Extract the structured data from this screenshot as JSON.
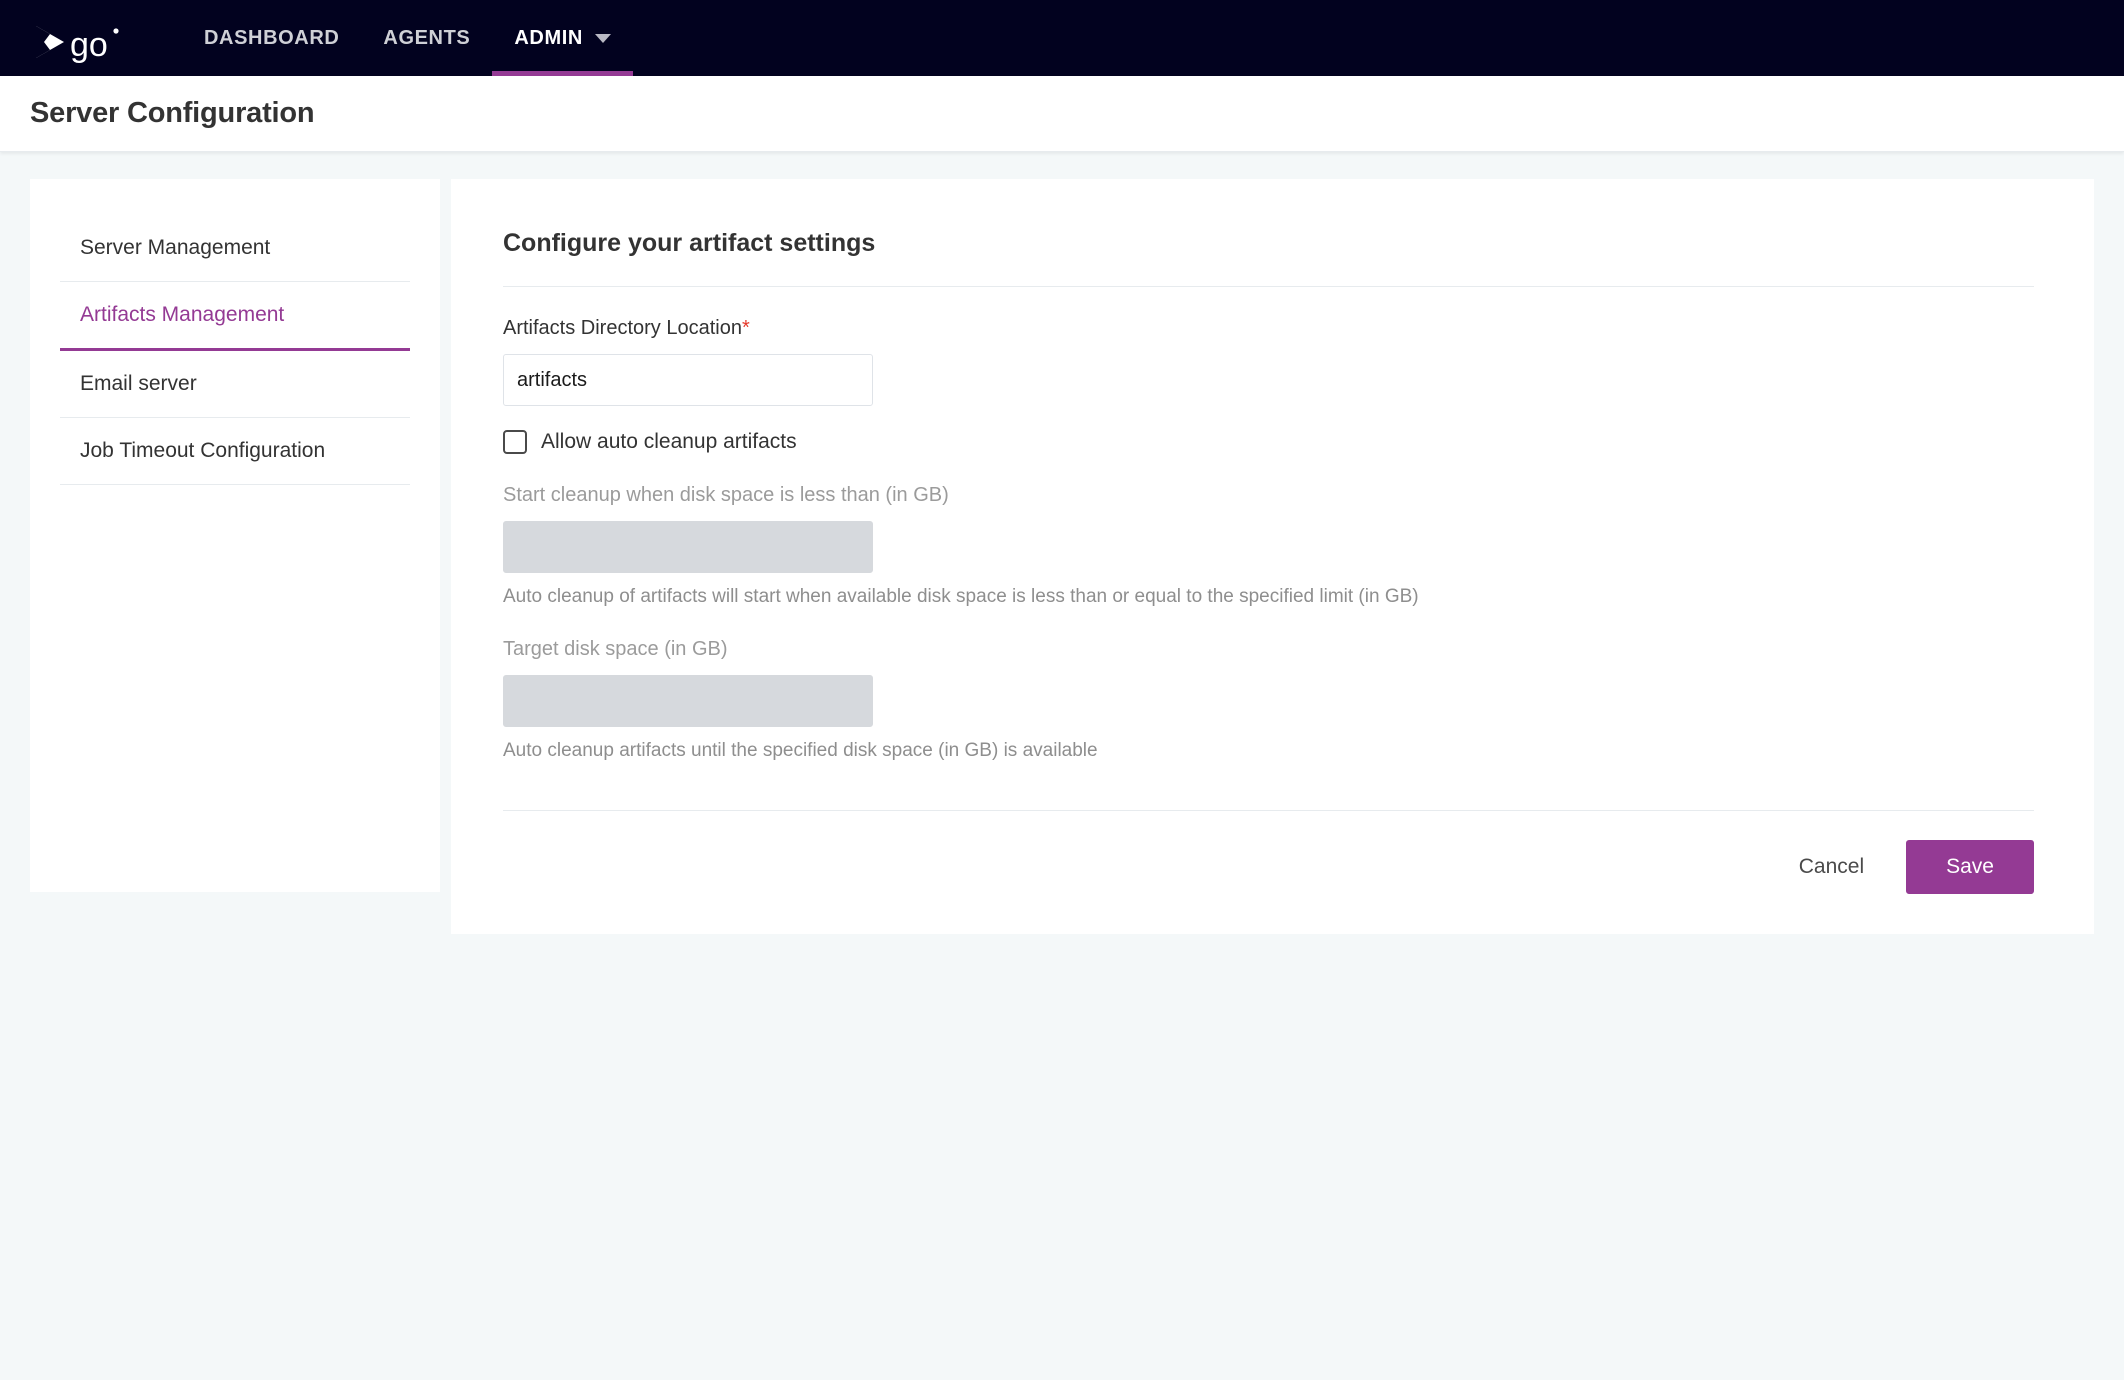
{
  "topnav": {
    "logo_alt": "go",
    "brand_color": "#02021f",
    "accent_color": "#943a94",
    "items": [
      {
        "label": "DASHBOARD",
        "active": false
      },
      {
        "label": "AGENTS",
        "active": false
      },
      {
        "label": "ADMIN",
        "active": true,
        "has_caret": true
      }
    ]
  },
  "header": {
    "title": "Server Configuration"
  },
  "sidebar": {
    "items": [
      {
        "label": "Server Management",
        "active": false
      },
      {
        "label": "Artifacts Management",
        "active": true
      },
      {
        "label": "Email server",
        "active": false
      },
      {
        "label": "Job Timeout Configuration",
        "active": false
      }
    ]
  },
  "panel": {
    "title": "Configure your artifact settings",
    "artifacts_dir": {
      "label": "Artifacts Directory Location",
      "required_marker": "*",
      "value": "artifacts",
      "placeholder": ""
    },
    "allow_cleanup": {
      "label": "Allow auto cleanup artifacts",
      "checked": false
    },
    "start_cleanup": {
      "label": "Start cleanup when disk space is less than (in GB)",
      "value": "",
      "placeholder": "",
      "disabled": true,
      "help": "Auto cleanup of artifacts will start when available disk space is less than or equal to the specified limit (in GB)"
    },
    "target_disk": {
      "label": "Target disk space (in GB)",
      "value": "",
      "placeholder": "",
      "disabled": true,
      "help": "Auto cleanup artifacts until the specified disk space (in GB) is available"
    },
    "actions": {
      "cancel_label": "Cancel",
      "save_label": "Save"
    }
  },
  "colors": {
    "accent_purple": "#943a94",
    "required_red": "#e5382a",
    "nav_bg": "#02021f",
    "page_bg": "#f4f8f9",
    "disabled_field": "#d6d9dd"
  }
}
